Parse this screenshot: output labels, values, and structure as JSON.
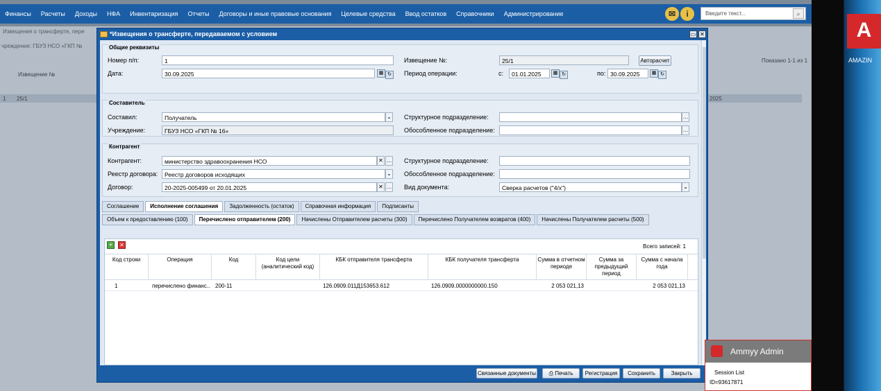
{
  "menu": [
    "Финансы",
    "Расчеты",
    "Доходы",
    "НФА",
    "Инвентаризация",
    "Отчеты",
    "Договоры и иные правовые основания",
    "Целевые средства",
    "Ввод остатков",
    "Справочники",
    "Администрирование"
  ],
  "search_placeholder": "Введите текст...",
  "bg": {
    "title": "Извещения о трансферте, пере",
    "inst_label": "чреждение:",
    "inst_value": "ГБУЗ НСО «ГКП №",
    "col": "Извещение №",
    "shown": "Показано 1-1 из 1",
    "row_n": "1",
    "row_v": "25/1",
    "row_v2": "2025"
  },
  "dialog": {
    "title": "*Извещения о трансферте, передаваемом с условием"
  },
  "general": {
    "legend": "Общие реквизиты",
    "num_label": "Номер п/п:",
    "num_value": "1",
    "date_label": "Дата:",
    "date_value": "30.09.2025",
    "notice_label": "Извещение №:",
    "notice_value": "25/1",
    "autocalc": "Авторасчет",
    "period_label": "Период операции:",
    "from_label": "с:",
    "from_value": "01.01.2025",
    "to_label": "по:",
    "to_value": "30.09.2025"
  },
  "author": {
    "legend": "Составитель",
    "composed_label": "Составил:",
    "composed_value": "Получатель",
    "inst_label": "Учреждение:",
    "inst_value": "ГБУЗ НСО «ГКП № 16»",
    "struct_label": "Структурное подразделение:",
    "sep_label": "Обособленное подразделение:"
  },
  "contr": {
    "legend": "Контрагент",
    "contr_label": "Контрагент:",
    "contr_value": "министерство здравоохранения НСО",
    "registry_label": "Реестр договора:",
    "registry_value": "Реестр договоров исходящих",
    "contract_label": "Договор:",
    "contract_value": "20-2025-005499 от 20.01.2025",
    "struct_label": "Структурное подразделение:",
    "sep_label": "Обособленное подразделение:",
    "doctype_label": "Вид документа:",
    "doctype_value": "Сверка расчетов (\"4/х\")"
  },
  "tabs1": [
    "Соглашение",
    "Исполнение соглашения",
    "Задолженность (остаток)",
    "Справочная информация",
    "Подписанты"
  ],
  "tabs2": [
    "Объем к предоставлению (100)",
    "Перечислено отправителем (200)",
    "Начислены Отправителем расчеты (300)",
    "Перечислено Получателем возвратов (400)",
    "Начислены Получателем расчеты (500)"
  ],
  "grid": {
    "total": "Всего записей:  1",
    "cols": [
      "Код строки",
      "Операция",
      "Код",
      "Код цели (аналитический код)",
      "КБК отправителя трансферта",
      "КБК получателя трансферта",
      "Сумма в отчетном периоде",
      "Сумма за предыдущий период",
      "Сумма с начала года"
    ],
    "row": [
      "1",
      "перечислено финанс...",
      "200-11",
      "",
      "126.0909.011Д153653.612",
      "126.0909.0000000000.150",
      "2 053 021,13",
      "",
      "2 053 021,13"
    ]
  },
  "footer": {
    "related": "Связанные документы",
    "print": "Печать",
    "register": "Регистрация",
    "save": "Сохранить",
    "close": "Закрыть"
  },
  "side": {
    "amazing": "AMAZIN"
  },
  "ammyy": {
    "title": "Ammyy Admin",
    "session": "Session List",
    "id": "ID=93617871"
  }
}
